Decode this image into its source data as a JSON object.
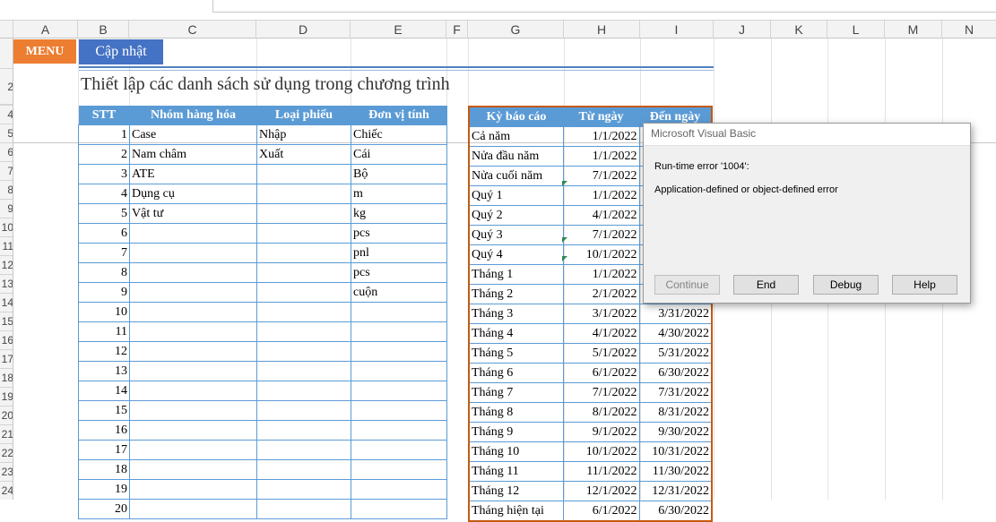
{
  "columns": [
    "A",
    "B",
    "C",
    "D",
    "E",
    "F",
    "G",
    "H",
    "I",
    "J",
    "K",
    "L",
    "M",
    "N"
  ],
  "rows": [
    "",
    "2",
    "",
    "4",
    "5",
    "6",
    "7",
    "8",
    "9",
    "10",
    "11",
    "12",
    "13",
    "14",
    "15",
    "16",
    "17",
    "18",
    "19",
    "20",
    "21",
    "22",
    "23",
    "24"
  ],
  "buttons": {
    "menu": "MENU",
    "update": "Cập nhật"
  },
  "page_title": "Thiết lập các danh sách sử dụng trong chương trình",
  "table1": {
    "headers": [
      "STT",
      "Nhóm hàng hóa",
      "Loại phiếu",
      "Đơn vị tính"
    ],
    "rows": [
      [
        "1",
        "Case",
        "Nhập",
        "Chiếc"
      ],
      [
        "2",
        "Nam châm",
        "Xuất",
        "Cái"
      ],
      [
        "3",
        "ATE",
        "",
        "Bộ"
      ],
      [
        "4",
        "Dụng cụ",
        "",
        "m"
      ],
      [
        "5",
        "Vật tư",
        "",
        "kg"
      ],
      [
        "6",
        "",
        "",
        "pcs"
      ],
      [
        "7",
        "",
        "",
        "pnl"
      ],
      [
        "8",
        "",
        "",
        "pcs"
      ],
      [
        "9",
        "",
        "",
        "cuộn"
      ],
      [
        "10",
        "",
        "",
        ""
      ],
      [
        "11",
        "",
        "",
        ""
      ],
      [
        "12",
        "",
        "",
        ""
      ],
      [
        "13",
        "",
        "",
        ""
      ],
      [
        "14",
        "",
        "",
        ""
      ],
      [
        "15",
        "",
        "",
        ""
      ],
      [
        "16",
        "",
        "",
        ""
      ],
      [
        "17",
        "",
        "",
        ""
      ],
      [
        "18",
        "",
        "",
        ""
      ],
      [
        "19",
        "",
        "",
        ""
      ],
      [
        "20",
        "",
        "",
        ""
      ]
    ]
  },
  "table2": {
    "headers": [
      "Kỳ báo cáo",
      "Từ ngày",
      "Đến ngày"
    ],
    "rows": [
      [
        "Cả năm",
        "1/1/2022",
        ""
      ],
      [
        "Nửa đầu năm",
        "1/1/2022",
        ""
      ],
      [
        "Nửa cuối năm",
        "7/1/2022",
        ""
      ],
      [
        "Quý 1",
        "1/1/2022",
        ""
      ],
      [
        "Quý 2",
        "4/1/2022",
        ""
      ],
      [
        "Quý 3",
        "7/1/2022",
        ""
      ],
      [
        "Quý 4",
        "10/1/2022",
        ""
      ],
      [
        "Tháng 1",
        "1/1/2022",
        ""
      ],
      [
        "Tháng 2",
        "2/1/2022",
        ""
      ],
      [
        "Tháng 3",
        "3/1/2022",
        "3/31/2022"
      ],
      [
        "Tháng 4",
        "4/1/2022",
        "4/30/2022"
      ],
      [
        "Tháng 5",
        "5/1/2022",
        "5/31/2022"
      ],
      [
        "Tháng 6",
        "6/1/2022",
        "6/30/2022"
      ],
      [
        "Tháng 7",
        "7/1/2022",
        "7/31/2022"
      ],
      [
        "Tháng 8",
        "8/1/2022",
        "8/31/2022"
      ],
      [
        "Tháng 9",
        "9/1/2022",
        "9/30/2022"
      ],
      [
        "Tháng 10",
        "10/1/2022",
        "10/31/2022"
      ],
      [
        "Tháng 11",
        "11/1/2022",
        "11/30/2022"
      ],
      [
        "Tháng 12",
        "12/1/2022",
        "12/31/2022"
      ],
      [
        "Tháng hiện tại",
        "6/1/2022",
        "6/30/2022"
      ]
    ]
  },
  "dialog": {
    "title": "Microsoft Visual Basic",
    "message1": "Run-time error '1004':",
    "message2": "Application-defined or object-defined error",
    "buttons": [
      "Continue",
      "End",
      "Debug",
      "Help"
    ]
  },
  "colors": {
    "header_blue": "#5b9bd5",
    "menu_orange": "#ed7d31",
    "update_blue": "#4472c4",
    "outline_orange": "#c55a11"
  }
}
